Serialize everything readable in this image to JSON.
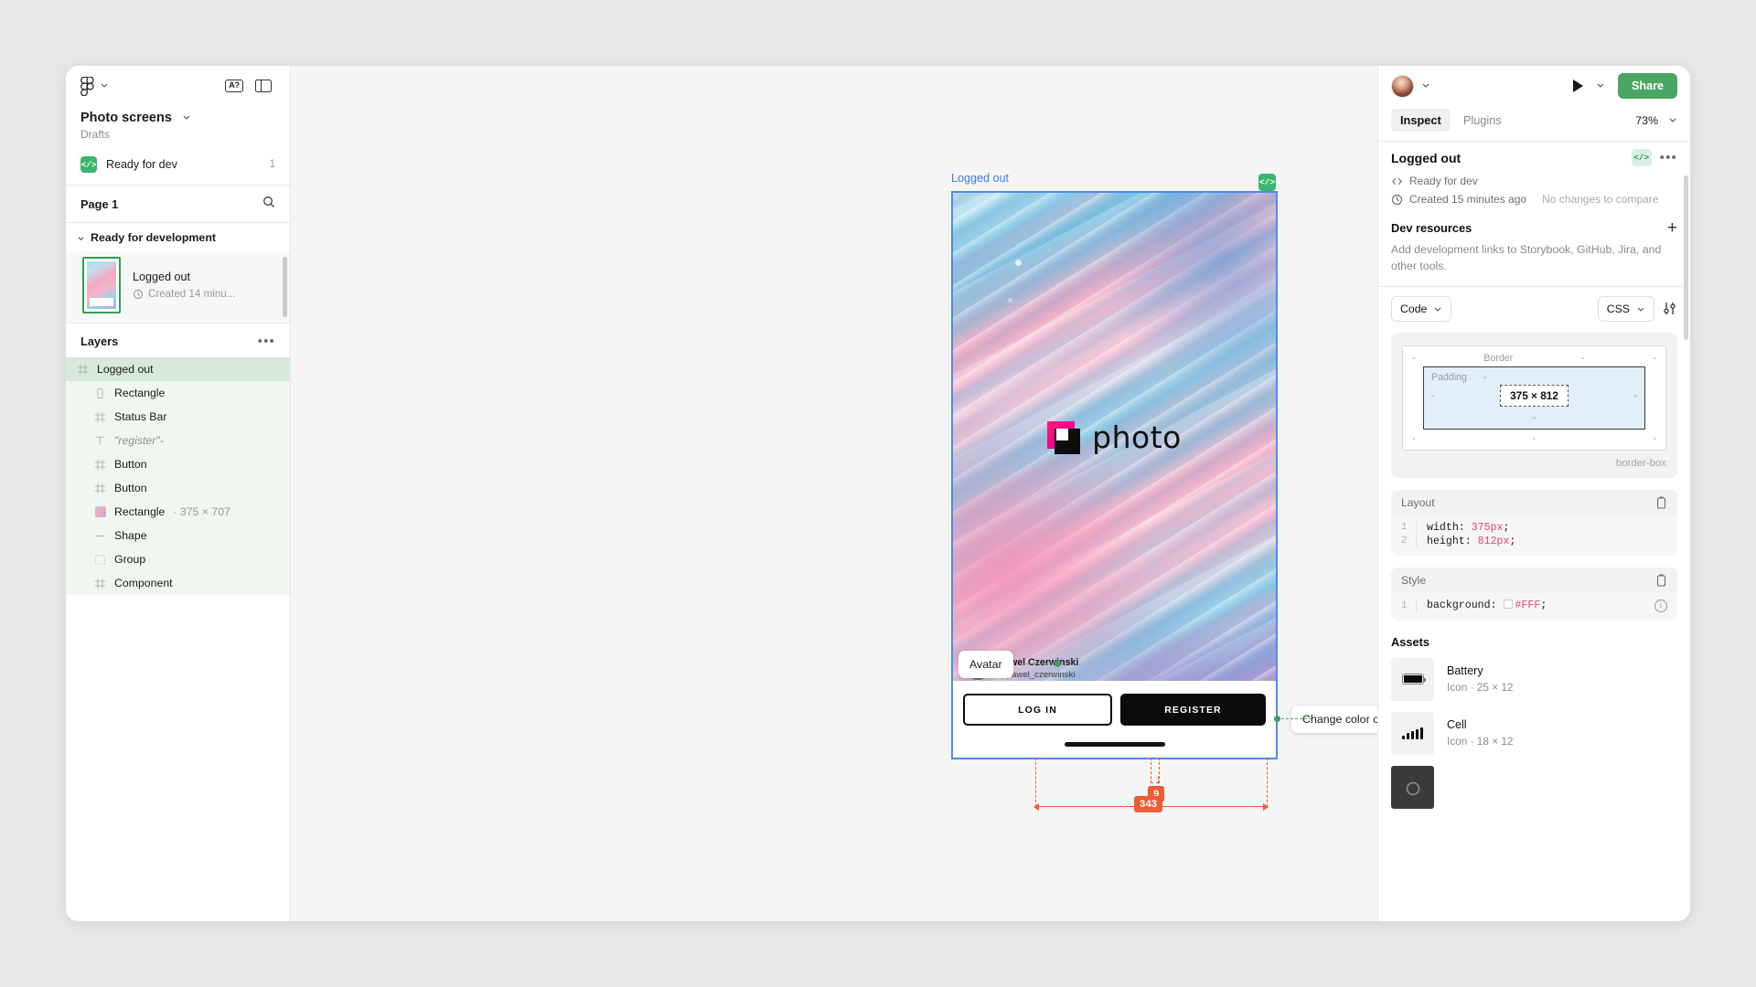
{
  "left_panel": {
    "toolbar": {
      "figma_logo": "figma-logo-icon",
      "menu_chevron": "chevron-down-icon",
      "font_tool_label": "A?",
      "panel_toggle": "panel-layout-icon"
    },
    "file_title": "Photo screens",
    "file_subtitle": "Drafts",
    "ready_for_dev": {
      "label": "Ready for dev",
      "count": "1",
      "badge": "</>"
    },
    "page_name": "Page 1",
    "search_icon": "search-icon",
    "section": {
      "title": "Ready for development"
    },
    "thumb_card": {
      "title": "Logged out",
      "meta": "Created 14 minu...",
      "clock_icon": "clock-icon"
    },
    "layers_header": {
      "title": "Layers",
      "more": "•••"
    },
    "layers": [
      {
        "name": "Logged out",
        "icon": "component-icon",
        "dim": "",
        "selected": true,
        "indent": false,
        "italic": false
      },
      {
        "name": "Rectangle",
        "icon": "rectangle-icon",
        "dim": "",
        "selected": false,
        "indent": true,
        "italic": false
      },
      {
        "name": "Status Bar",
        "icon": "component-icon",
        "dim": "",
        "selected": false,
        "indent": true,
        "italic": false
      },
      {
        "name": "\"register\"-",
        "icon": "text-icon",
        "dim": "",
        "selected": false,
        "indent": true,
        "italic": true
      },
      {
        "name": "Button",
        "icon": "component-icon",
        "dim": "",
        "selected": false,
        "indent": true,
        "italic": false
      },
      {
        "name": "Button",
        "icon": "component-icon",
        "dim": "",
        "selected": false,
        "indent": true,
        "italic": false
      },
      {
        "name": "Rectangle",
        "icon": "image-icon",
        "dim": "· 375 × 707",
        "selected": false,
        "indent": true,
        "italic": false
      },
      {
        "name": "Shape",
        "icon": "line-icon",
        "dim": "",
        "selected": false,
        "indent": true,
        "italic": false
      },
      {
        "name": "Group",
        "icon": "group-icon",
        "dim": "",
        "selected": false,
        "indent": true,
        "italic": false
      },
      {
        "name": "Component",
        "icon": "component-icon",
        "dim": "",
        "selected": false,
        "indent": true,
        "italic": false
      }
    ]
  },
  "canvas": {
    "frame_label": "Logged out",
    "frame_code_badge": "</>",
    "mockup": {
      "logo_text": "photo",
      "author_name": "Pawel Czerwinski",
      "author_handle": "@pawel_czerwinski",
      "login_button": "LOG IN",
      "register_button": "REGISTER"
    },
    "annotations": [
      {
        "text": "Avatar"
      },
      {
        "text": "Change color on click"
      }
    ],
    "measurements": {
      "gap": "9",
      "width": "343"
    }
  },
  "right_panel": {
    "top": {
      "avatar": "user-avatar",
      "account_chevron": "chevron-down-icon",
      "play_icon": "play-icon",
      "play_chevron": "chevron-down-icon",
      "share_label": "Share"
    },
    "tabs": [
      {
        "label": "Inspect",
        "active": true
      },
      {
        "label": "Plugins",
        "active": false
      }
    ],
    "zoom": "73%",
    "selection": {
      "title": "Logged out",
      "code_badge": "</>",
      "more": "•••",
      "status_icon": "code-icon",
      "status": "Ready for dev",
      "created_icon": "clock-icon",
      "created": "Created 15 minutes ago",
      "compare": "No changes to compare"
    },
    "dev_resources": {
      "title": "Dev resources",
      "add_icon": "plus-icon",
      "description": "Add development links to Storybook, GitHub, Jira, and other tools."
    },
    "code_controls": {
      "code_select": "Code",
      "lang_select": "CSS",
      "settings_icon": "sliders-icon"
    },
    "box_model": {
      "border_label": "Border",
      "padding_label": "Padding",
      "content_size": "375 × 812",
      "dash": "-",
      "sizing": "border-box"
    },
    "layout_card": {
      "title": "Layout",
      "copy_icon": "copy-icon",
      "lines": [
        {
          "num": "1",
          "prop": "width:",
          "value": "375px",
          "semi": ";"
        },
        {
          "num": "2",
          "prop": "height:",
          "value": "812px",
          "semi": ";"
        }
      ]
    },
    "style_card": {
      "title": "Style",
      "copy_icon": "copy-icon",
      "info_icon": "info-icon",
      "lines": [
        {
          "num": "1",
          "prop": "background:",
          "value": "#FFF",
          "semi": ";"
        }
      ]
    },
    "assets": {
      "title": "Assets",
      "items": [
        {
          "name": "Battery",
          "meta": "Icon · 25 × 12",
          "icon": "battery-icon"
        },
        {
          "name": "Cell",
          "meta": "Icon · 18 × 12",
          "icon": "cell-signal-icon"
        },
        {
          "name": "",
          "meta": "",
          "icon": "camera-icon"
        }
      ]
    }
  },
  "colors": {
    "accent_blue": "#4a8df0",
    "green": "#3cb46e",
    "share_green": "#4aa663",
    "measure_orange": "#ef5b34",
    "anno_green": "#3e9e5f",
    "code_value_pink": "#e0457b"
  }
}
